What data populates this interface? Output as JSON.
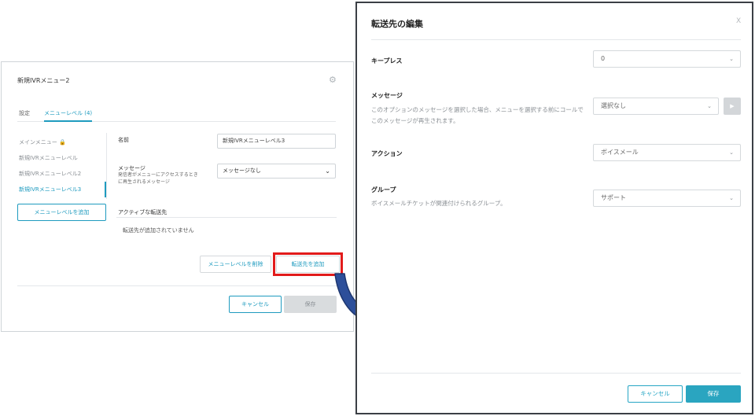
{
  "left_panel": {
    "title": "新規IVRメニュー2",
    "tabs": [
      {
        "label": "設定"
      },
      {
        "label": "メニューレベル (4)"
      }
    ],
    "side_items": [
      {
        "label": "メインメニュー 🔒"
      },
      {
        "label": "新規IVRメニューレベル"
      },
      {
        "label": "新規IVRメニューレベル2"
      },
      {
        "label": "新規IVRメニューレベル3"
      }
    ],
    "add_level_button": "メニューレベルを追加",
    "name_label": "名前",
    "name_value": "新規IVRメニューレベル3",
    "message_label": "メッセージ",
    "message_sub_line1": "発信者がメニューにアクセスするとき",
    "message_sub_line2": "に再生されるメッセージ",
    "message_select_value": "メッセージなし",
    "active_transfers_label": "アクティブな転送先",
    "no_transfers_text": "転送先が追加されていません",
    "delete_level_button": "メニューレベルを削除",
    "add_transfer_button": "転送先を追加",
    "cancel_button": "キャンセル",
    "save_button": "保存"
  },
  "modal": {
    "title": "転送先の編集",
    "close_glyph": "X",
    "keypress_label": "キープレス",
    "keypress_value": "0",
    "message_label": "メッセージ",
    "message_sub_line1": "このオプションのメッセージを選択した場合、メニューを選択する前にコールで",
    "message_sub_line2": "このメッセージが再生されます。",
    "message_value": "選択なし",
    "action_label": "アクション",
    "action_value": "ボイスメール",
    "group_label": "グループ",
    "group_sub": "ボイスメールチケットが関連付けられるグループ。",
    "group_value": "サポート",
    "cancel_button": "キャンセル",
    "save_button": "保存"
  },
  "icons": {
    "gear": "gear-icon",
    "dropdown": "chevron-down-icon",
    "play": "play-icon",
    "close": "close-icon",
    "arrow": "curved-arrow-icon"
  },
  "colors": {
    "accent": "#1f9bbf",
    "highlight": "#e21b1b",
    "arrow": "#2d4f9a"
  }
}
